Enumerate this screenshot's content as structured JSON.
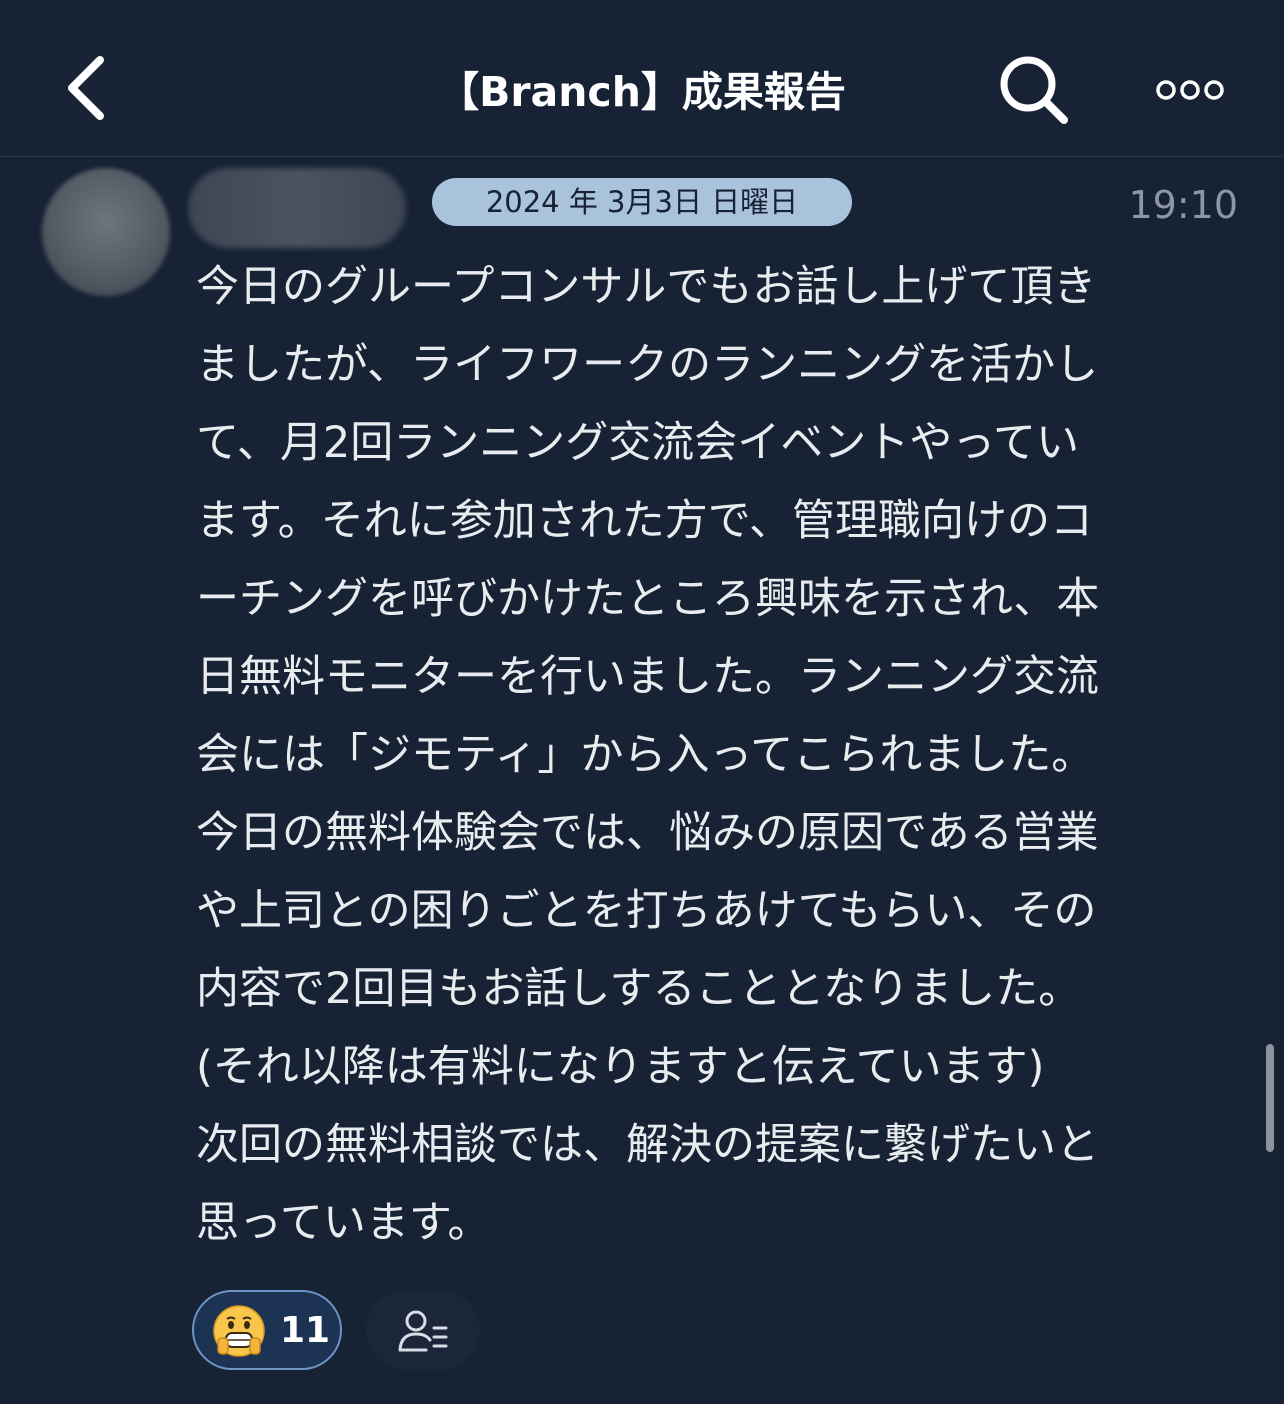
{
  "header": {
    "title": "【Branch】成果報告",
    "back_icon": "chevron-left-icon",
    "search_icon": "search-icon",
    "more_icon": "more-dots-icon"
  },
  "post": {
    "date": "2024 年 3月3日 日曜日",
    "time": "19:10",
    "lines": [
      "今日のグループコンサルでもお話し上げて頂き",
      "ましたが、ライフワークのランニングを活かし",
      "て、月2回ランニング交流会イベントやってい",
      "ます。それに参加された方で、管理職向けのコ",
      "ーチングを呼びかけたところ興味を示され、本",
      "日無料モニターを行いました。ランニング交流",
      "会には「ジモティ」から入ってこられました。",
      "今日の無料体験会では、悩みの原因である営業",
      "や上司との困りごとを打ちあけてもらい、その",
      "内容で2回目もお話しすることとなりました。",
      "(それ以降は有料になりますと伝えています)",
      "次回の無料相談では、解決の提案に繋げたいと",
      "思っています。"
    ]
  },
  "reactions": {
    "emoji_icon": "salute-face-icon",
    "count": "11",
    "readers_icon": "read-by-list-icon"
  },
  "colors": {
    "background": "#172235",
    "date_pill": "#a9c3dd",
    "reaction_border": "#6f95c6"
  }
}
